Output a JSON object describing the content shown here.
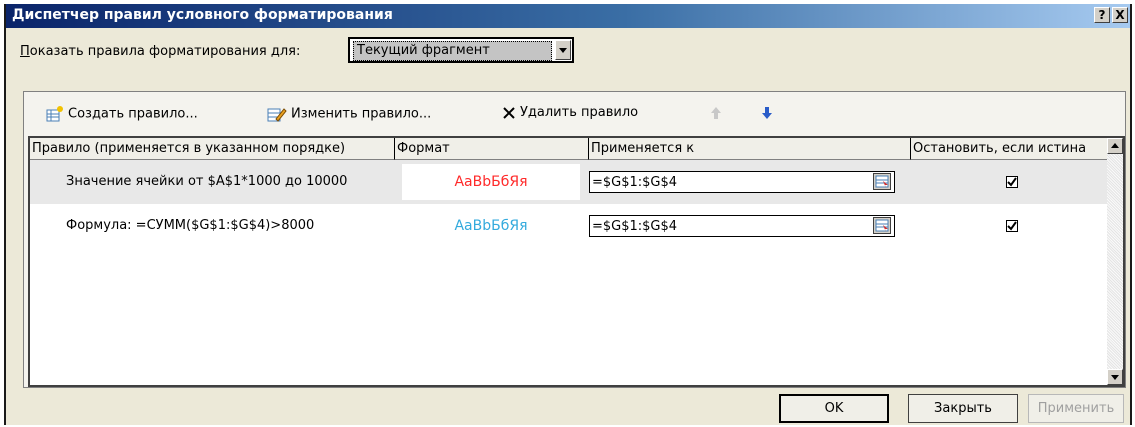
{
  "window": {
    "title": "Диспетчер правил условного форматирования",
    "help": "?",
    "close": "X"
  },
  "show_rules": {
    "label": "Показать правила форматирования для:",
    "selected": "Текущий фрагмент"
  },
  "toolbar": {
    "new_rule": "Создать правило...",
    "edit_rule": "Изменить правило...",
    "delete_rule": "Удалить правило"
  },
  "columns": [
    "Правило (применяется в указанном порядке)",
    "Формат",
    "Применяется к",
    "Остановить, если истина"
  ],
  "rules": [
    {
      "rule": "Значение ячейки от $A$1*1000 до 10000",
      "format_preview": "АаBbБбЯя",
      "format_color": "#ff2a2a",
      "applies_to": "=$G$1:$G$4",
      "stop_if_true": true,
      "selected": true
    },
    {
      "rule": "Формула: =СУММ($G$1:$G$4)>8000",
      "format_preview": "АаBbБбЯя",
      "format_color": "#33aadd",
      "applies_to": "=$G$1:$G$4",
      "stop_if_true": true,
      "selected": false
    }
  ],
  "buttons": {
    "ok": "OK",
    "close": "Закрыть",
    "apply": "Применить"
  }
}
